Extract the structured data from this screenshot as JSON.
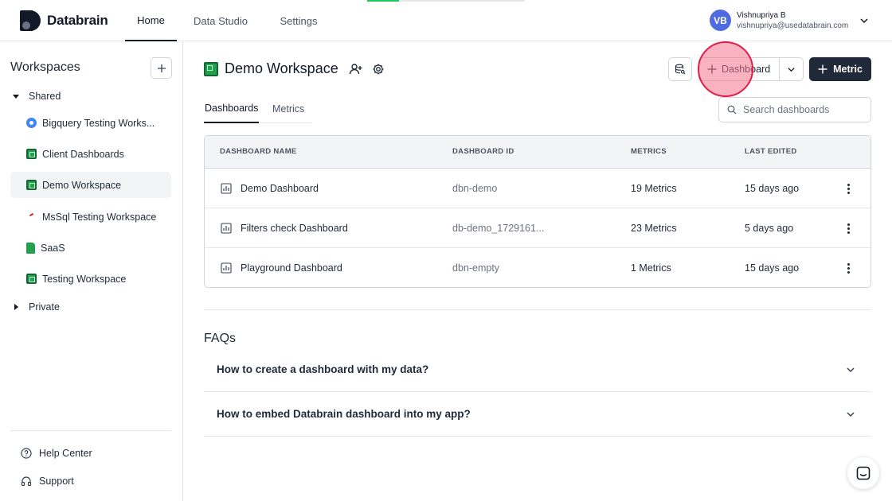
{
  "app": {
    "name": "Databrain"
  },
  "topnav": {
    "home": "Home",
    "data_studio": "Data Studio",
    "settings": "Settings"
  },
  "user": {
    "initials": "VB",
    "name": "Vishnupriya B",
    "email": "vishnupriya@usedatabrain.com"
  },
  "sidebar": {
    "title": "Workspaces",
    "shared_label": "Shared",
    "private_label": "Private",
    "items": [
      {
        "label": "Bigquery Testing Works...",
        "icon": "bigquery-icon"
      },
      {
        "label": "Client Dashboards",
        "icon": "sheet-icon"
      },
      {
        "label": "Demo Workspace",
        "icon": "sheet-icon",
        "active": true
      },
      {
        "label": "MsSql Testing Workspace",
        "icon": "mssql-icon"
      },
      {
        "label": "SaaS",
        "icon": "file-icon"
      },
      {
        "label": "Testing Workspace",
        "icon": "sheet-icon"
      }
    ],
    "help_center": "Help Center",
    "support": "Support"
  },
  "workspace": {
    "title": "Demo Workspace"
  },
  "toolbar": {
    "dashboard_label": "Dashboard",
    "metric_label": "Metric"
  },
  "tabs": {
    "dashboards": "Dashboards",
    "metrics": "Metrics"
  },
  "search": {
    "placeholder": "Search dashboards"
  },
  "table": {
    "headers": {
      "name": "DASHBOARD NAME",
      "id": "DASHBOARD ID",
      "metrics": "METRICS",
      "edited": "LAST EDITED"
    },
    "rows": [
      {
        "name": "Demo Dashboard",
        "id": "dbn-demo",
        "metrics": "19 Metrics",
        "edited": "15 days ago"
      },
      {
        "name": "Filters check Dashboard",
        "id": "db-demo_1729161...",
        "metrics": "23 Metrics",
        "edited": "5 days ago"
      },
      {
        "name": "Playground Dashboard",
        "id": "dbn-empty",
        "metrics": "1 Metrics",
        "edited": "15 days ago"
      }
    ]
  },
  "faqs": {
    "title": "FAQs",
    "items": [
      {
        "question": "How to create a dashboard with my data?"
      },
      {
        "question": "How to embed Databrain dashboard into my app?"
      }
    ]
  },
  "colors": {
    "primary_dark": "#1f2937",
    "avatar": "#4f6bde",
    "sheet_green": "#22a04b",
    "highlight": "#f4728a"
  }
}
